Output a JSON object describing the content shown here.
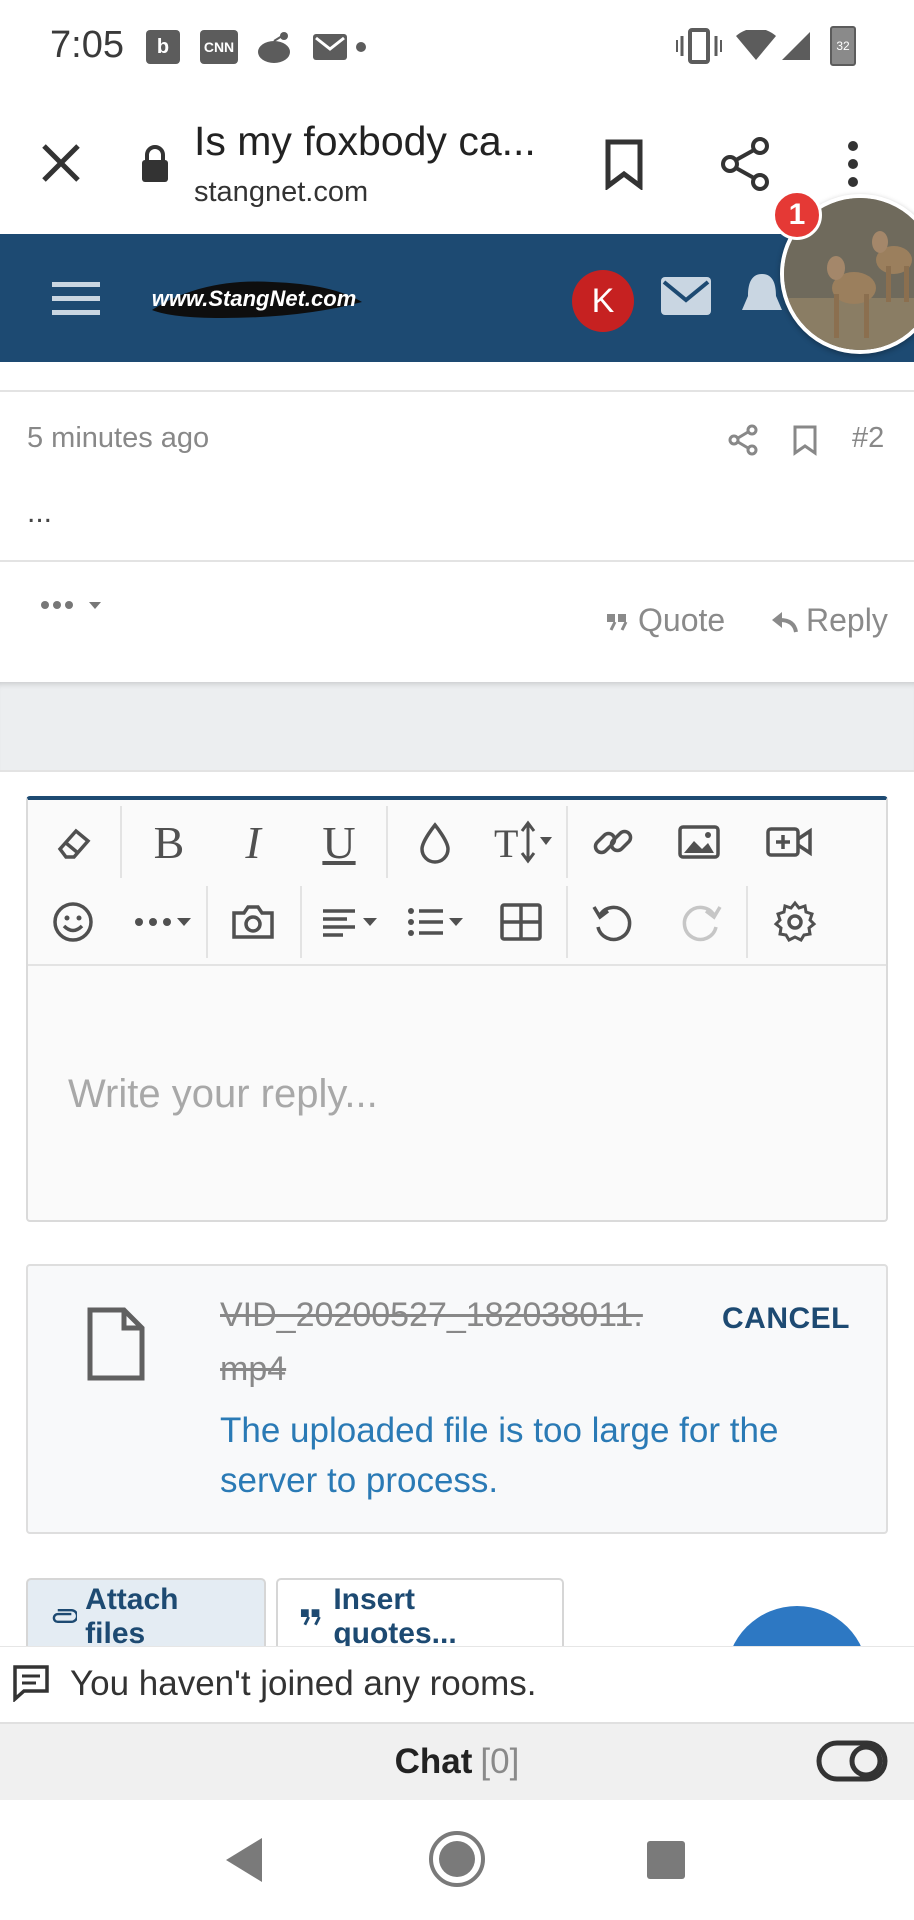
{
  "status_bar": {
    "time": "7:05",
    "notifications": [
      "b",
      "CNN"
    ],
    "battery": "32"
  },
  "browser": {
    "page_title": "Is my foxbody ca...",
    "domain": "stangnet.com"
  },
  "site_header": {
    "logo_text": "www.StangNet.com",
    "user_initial": "K",
    "bubble_badge": "1"
  },
  "post": {
    "time": "5 minutes ago",
    "number": "#2",
    "body": "...",
    "quote_label": "Quote",
    "reply_label": "Reply"
  },
  "editor": {
    "placeholder": "Write your reply..."
  },
  "attachment": {
    "file_name": "VID_20200527_182038011.mp4",
    "cancel_label": "CANCEL",
    "error": "The uploaded file is too large for the server to process."
  },
  "buttons": {
    "attach_files": "Attach files",
    "insert_quotes": "Insert quotes..."
  },
  "chat": {
    "rooms_message": "You haven't joined any rooms.",
    "label": "Chat",
    "count": "[0]"
  },
  "colors": {
    "header_bg": "#1d4a72",
    "link_blue": "#2a7ab5",
    "badge_red": "#e53935"
  }
}
